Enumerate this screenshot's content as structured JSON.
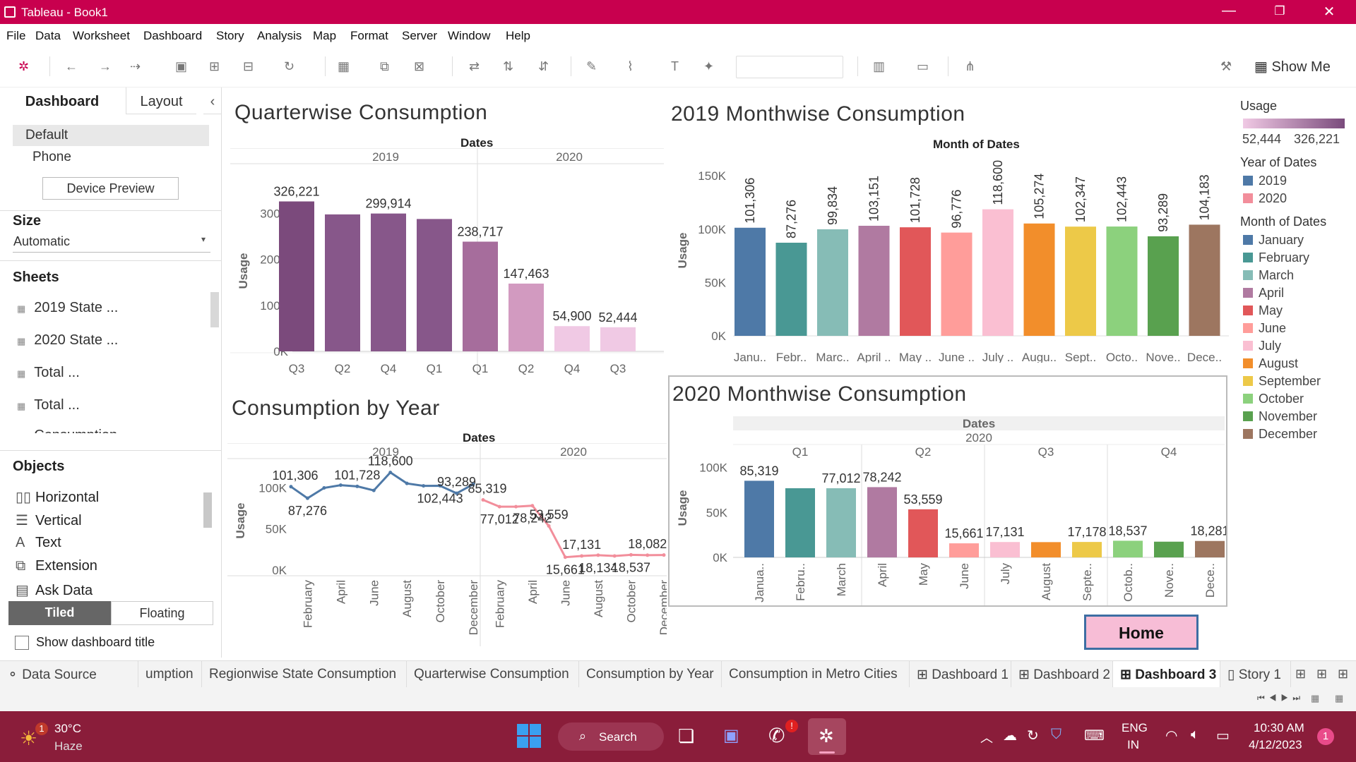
{
  "window": {
    "title": "Tableau - Book1",
    "minimize": "—",
    "restore": "❐",
    "close": "✕"
  },
  "menu": [
    "File",
    "Data",
    "Worksheet",
    "Dashboard",
    "Story",
    "Analysis",
    "Map",
    "Format",
    "Server",
    "Window",
    "Help"
  ],
  "toolbar": {
    "show_me": "Show Me"
  },
  "left_panel": {
    "tabs": [
      "Dashboard",
      "Layout"
    ],
    "collapse": "‹",
    "device": {
      "default": "Default",
      "phone": "Phone",
      "preview_button": "Device Preview"
    },
    "size": {
      "title": "Size",
      "value": "Automatic"
    },
    "sheets": {
      "title": "Sheets",
      "items": [
        "2019 State ...",
        "2020 State ...",
        "Total ...",
        "Total ...",
        "Consumption ..."
      ]
    },
    "objects": {
      "title": "Objects",
      "items": [
        "Horizontal",
        "Vertical",
        "Text",
        "Extension",
        "Ask Data"
      ]
    },
    "tiled": "Tiled",
    "floating": "Floating",
    "show_title": "Show dashboard title"
  },
  "legend": {
    "usage_title": "Usage",
    "usage_min": "52,444",
    "usage_max": "326,221",
    "year_title": "Year of Dates",
    "years": [
      {
        "label": "2019",
        "color": "#4e79a7"
      },
      {
        "label": "2020",
        "color": "#f28e9b"
      }
    ],
    "month_title": "Month of Dates",
    "months": [
      {
        "label": "January",
        "color": "#4e79a7"
      },
      {
        "label": "February",
        "color": "#499894"
      },
      {
        "label": "March",
        "color": "#86bcb6"
      },
      {
        "label": "April",
        "color": "#b07aa1"
      },
      {
        "label": "May",
        "color": "#e15759"
      },
      {
        "label": "June",
        "color": "#ff9d9a"
      },
      {
        "label": "July",
        "color": "#fabfd2"
      },
      {
        "label": "August",
        "color": "#f28e2b"
      },
      {
        "label": "September",
        "color": "#edc948"
      },
      {
        "label": "October",
        "color": "#8cd17d"
      },
      {
        "label": "November",
        "color": "#59a14f"
      },
      {
        "label": "December",
        "color": "#9d7660"
      }
    ]
  },
  "home_button": "Home",
  "sheet_tabs": [
    "Data Source",
    "umption",
    "Regionwise State Consumption",
    "Quarterwise Consumption",
    "Consumption by Year",
    "Consumption in Metro Cities",
    "Dashboard 1",
    "Dashboard 2",
    "Dashboard 3",
    "Story 1"
  ],
  "taskbar": {
    "temp": "30°C",
    "weather": "Haze",
    "weather_badge": "1",
    "search": "Search",
    "lang1": "ENG",
    "lang2": "IN",
    "time": "10:30 AM",
    "date": "4/12/2023",
    "notif": "1"
  },
  "chart_data": [
    {
      "type": "bar",
      "title": "Quarterwise Consumption",
      "column_header": "Dates",
      "groups": [
        "2019",
        "2020"
      ],
      "ylabel": "Usage",
      "ylim": [
        0,
        350000
      ],
      "yticks": [
        "0K",
        "100K",
        "200K",
        "300K"
      ],
      "categories": [
        {
          "year": "2019",
          "quarter": "Q3",
          "value": 326221,
          "label": "326,221"
        },
        {
          "year": "2019",
          "quarter": "Q2",
          "value": 298000,
          "label": ""
        },
        {
          "year": "2019",
          "quarter": "Q4",
          "value": 299914,
          "label": "299,914"
        },
        {
          "year": "2019",
          "quarter": "Q1",
          "value": 288000,
          "label": ""
        },
        {
          "year": "2020",
          "quarter": "Q1",
          "value": 238717,
          "label": "238,717"
        },
        {
          "year": "2020",
          "quarter": "Q2",
          "value": 147463,
          "label": "147,463"
        },
        {
          "year": "2020",
          "quarter": "Q4",
          "value": 54900,
          "label": "54,900"
        },
        {
          "year": "2020",
          "quarter": "Q3",
          "value": 52444,
          "label": "52,444"
        }
      ]
    },
    {
      "type": "bar",
      "title": "2019 Monthwise Consumption",
      "column_header": "Month of Dates",
      "ylabel": "Usage",
      "ylim": [
        0,
        160000
      ],
      "yticks": [
        "0K",
        "50K",
        "100K",
        "150K"
      ],
      "categories": [
        "Janu..",
        "Febr..",
        "Marc..",
        "April ..",
        "May ..",
        "June ..",
        "July ..",
        "Augu..",
        "Sept..",
        "Octo..",
        "Nove..",
        "Dece.."
      ],
      "values": [
        101306,
        87276,
        99834,
        103151,
        101728,
        96776,
        118600,
        105274,
        102347,
        102443,
        93289,
        104183
      ],
      "labels": [
        "101,306",
        "87,276",
        "99,834",
        "103,151",
        "101,728",
        "96,776",
        "118,600",
        "105,274",
        "102,347",
        "102,443",
        "93,289",
        "104,183"
      ]
    },
    {
      "type": "line",
      "title": "Consumption by Year",
      "column_header": "Dates",
      "groups": [
        "2019",
        "2020"
      ],
      "ylabel": "Usage",
      "ylim": [
        0,
        120000
      ],
      "yticks": [
        "0K",
        "50K",
        "100K"
      ],
      "xticks": [
        "February",
        "April",
        "June",
        "August",
        "October",
        "December"
      ],
      "series": [
        {
          "name": "2019",
          "values": [
            101306,
            87276,
            99834,
            103151,
            101728,
            96776,
            118600,
            105274,
            102347,
            102443,
            93289,
            104183
          ],
          "labels": [
            "101,306",
            "87,276",
            "",
            "",
            "101,728",
            "",
            "118,600",
            "",
            "",
            "102,443",
            "93,289",
            ""
          ]
        },
        {
          "name": "2020",
          "values": [
            85319,
            77012,
            77012,
            78242,
            53559,
            15661,
            17131,
            18134,
            17178,
            18537,
            18082,
            18281
          ],
          "labels": [
            "85,319",
            "77,012",
            "",
            "78,242",
            "53,559",
            "15,661",
            "17,131",
            "18,134",
            "",
            "18,537",
            "18,082",
            ""
          ]
        }
      ]
    },
    {
      "type": "bar",
      "title": "2020 Monthwise Consumption",
      "column_header": "Dates",
      "subheader": "2020",
      "groups": [
        "Q1",
        "Q2",
        "Q3",
        "Q4"
      ],
      "ylabel": "Usage",
      "ylim": [
        0,
        110000
      ],
      "yticks": [
        "0K",
        "50K",
        "100K"
      ],
      "categories": [
        "Janua..",
        "Febru..",
        "March",
        "April",
        "May",
        "June",
        "July",
        "August",
        "Septe..",
        "Octob..",
        "Nove..",
        "Dece.."
      ],
      "values": [
        85319,
        77012,
        77012,
        78242,
        53559,
        15661,
        17131,
        17000,
        17178,
        18537,
        17500,
        18281
      ],
      "labels": [
        "85,319",
        "",
        "77,012",
        "78,242",
        "53,559",
        "15,661",
        "17,131",
        "",
        "17,178",
        "18,537",
        "",
        "18,281"
      ]
    }
  ]
}
